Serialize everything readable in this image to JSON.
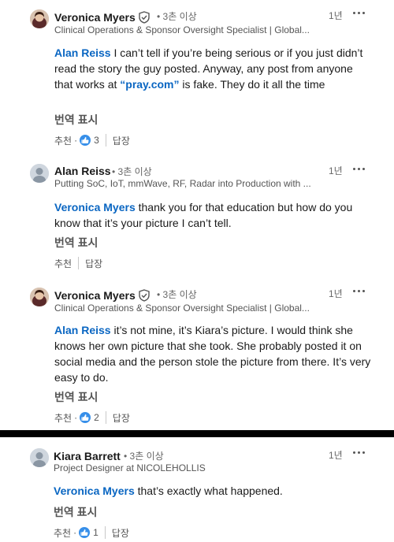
{
  "comments": [
    {
      "author": "Veronica Myers",
      "verified": true,
      "degree": "3촌 이상",
      "headline": "Clinical Operations & Sponsor Oversight Specialist | Global...",
      "time": "1년",
      "mention": "Alan Reiss",
      "text_before_link": " I can’t tell if you’re being serious or if you just didn’t read the story the guy posted. Anyway, any post from anyone that works at ",
      "link_text": "“pray.com”",
      "text_after_link": " is fake. They do it all the time",
      "translate": "번역 표시",
      "like_label": "추천",
      "reaction_count": "3",
      "reply_label": "답장"
    },
    {
      "author": "Alan Reiss",
      "verified": false,
      "degree": "3촌 이상",
      "headline": "Putting SoC, IoT, mmWave, RF, Radar into Production with ...",
      "time": "1년",
      "mention": "Veronica Myers",
      "text": " thank you for that education but how do you know that it’s your picture I can’t tell.",
      "translate": "번역 표시",
      "like_label": "추천",
      "reply_label": "답장"
    },
    {
      "author": "Veronica Myers",
      "verified": true,
      "degree": "3촌 이상",
      "headline": "Clinical Operations & Sponsor Oversight Specialist | Global...",
      "time": "1년",
      "mention": "Alan Reiss",
      "text": " it’s not mine, it’s Kiara’s picture. I would think she knows her own picture that she took. She probably posted it on social media and the person stole the picture from there. It’s very easy to do.",
      "translate": "번역 표시",
      "like_label": "추천",
      "reaction_count": "2",
      "reply_label": "답장"
    },
    {
      "author": "Kiara Barrett",
      "verified": false,
      "degree": "3촌 이상",
      "headline": "Project Designer at NICOLEHOLLIS",
      "time": "1년",
      "mention": "Veronica Myers",
      "text": " that’s exactly what happened.",
      "translate": "번역 표시",
      "like_label": "추천",
      "reaction_count": "1",
      "reply_label": "답장"
    }
  ]
}
